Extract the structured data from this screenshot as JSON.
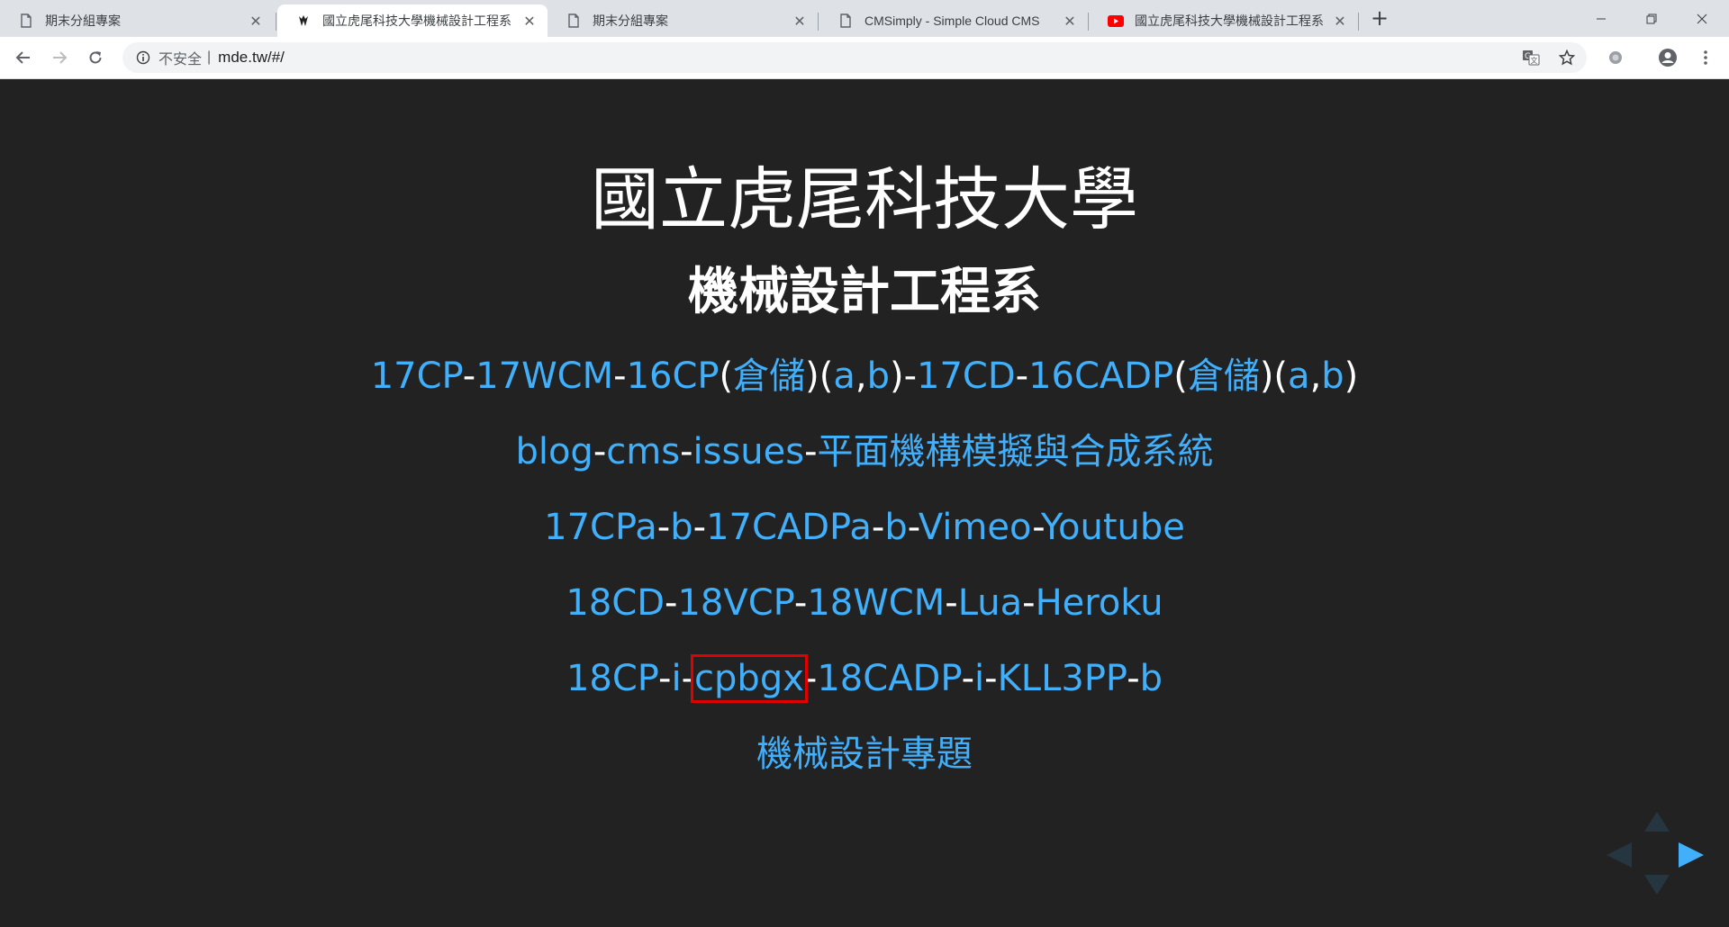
{
  "tabs": [
    {
      "title": "期末分組專案",
      "favicon": "page-icon",
      "active": false
    },
    {
      "title": "國立虎尾科技大學機械設計工程系",
      "favicon": "mde-logo-icon",
      "active": true
    },
    {
      "title": "期末分組專案",
      "favicon": "page-icon",
      "active": false
    },
    {
      "title": "CMSimply - Simple Cloud CMS",
      "favicon": "page-icon",
      "active": false
    },
    {
      "title": "國立虎尾科技大學機械設計工程系",
      "favicon": "youtube-icon",
      "active": false
    }
  ],
  "new_tab_label": "+",
  "omnibox": {
    "security": "不安全",
    "separator": "|",
    "url": "mde.tw/#/"
  },
  "page": {
    "title": "國立虎尾科技大學",
    "subtitle": "機械設計工程系",
    "lines": [
      {
        "segments": [
          {
            "text": "17CP",
            "type": "link"
          },
          {
            "text": "-",
            "type": "dash"
          },
          {
            "text": "17WCM",
            "type": "link"
          },
          {
            "text": "-",
            "type": "dash"
          },
          {
            "text": "16CP",
            "type": "link"
          },
          {
            "text": "(",
            "type": "dash"
          },
          {
            "text": "倉儲",
            "type": "link"
          },
          {
            "text": ")(",
            "type": "dash"
          },
          {
            "text": "a",
            "type": "link"
          },
          {
            "text": ",",
            "type": "dash"
          },
          {
            "text": "b",
            "type": "link"
          },
          {
            "text": ")-",
            "type": "dash"
          },
          {
            "text": "17CD",
            "type": "link"
          },
          {
            "text": "-",
            "type": "dash"
          },
          {
            "text": "16CADP",
            "type": "link"
          },
          {
            "text": "(",
            "type": "dash"
          },
          {
            "text": "倉儲",
            "type": "link"
          },
          {
            "text": ")(",
            "type": "dash"
          },
          {
            "text": "a",
            "type": "link"
          },
          {
            "text": ",",
            "type": "dash"
          },
          {
            "text": "b",
            "type": "link"
          },
          {
            "text": ")",
            "type": "dash"
          }
        ]
      },
      {
        "segments": [
          {
            "text": "blog",
            "type": "link"
          },
          {
            "text": "-",
            "type": "dash"
          },
          {
            "text": "cms",
            "type": "link"
          },
          {
            "text": "-",
            "type": "dash"
          },
          {
            "text": "issues",
            "type": "link"
          },
          {
            "text": "-",
            "type": "dash"
          },
          {
            "text": "平面機構模擬與合成系統",
            "type": "link"
          }
        ]
      },
      {
        "segments": [
          {
            "text": "17CPa",
            "type": "link"
          },
          {
            "text": "-",
            "type": "dash"
          },
          {
            "text": "b",
            "type": "link"
          },
          {
            "text": "-",
            "type": "dash"
          },
          {
            "text": "17CADPa",
            "type": "link"
          },
          {
            "text": "-",
            "type": "dash"
          },
          {
            "text": "b",
            "type": "link"
          },
          {
            "text": "-",
            "type": "dash"
          },
          {
            "text": "Vimeo",
            "type": "link"
          },
          {
            "text": "-",
            "type": "dash"
          },
          {
            "text": "Youtube",
            "type": "link"
          }
        ]
      },
      {
        "segments": [
          {
            "text": "18CD",
            "type": "link"
          },
          {
            "text": "-",
            "type": "dash"
          },
          {
            "text": "18VCP",
            "type": "link"
          },
          {
            "text": "-",
            "type": "dash"
          },
          {
            "text": "18WCM",
            "type": "link"
          },
          {
            "text": "-",
            "type": "dash"
          },
          {
            "text": "Lua",
            "type": "link"
          },
          {
            "text": "-",
            "type": "dash"
          },
          {
            "text": "Heroku",
            "type": "link"
          }
        ]
      },
      {
        "segments": [
          {
            "text": "18CP",
            "type": "link"
          },
          {
            "text": "-",
            "type": "dash"
          },
          {
            "text": "i",
            "type": "link"
          },
          {
            "text": "-",
            "type": "dash"
          },
          {
            "text": "cpbgx",
            "type": "link",
            "highlighted": true
          },
          {
            "text": "-",
            "type": "dash"
          },
          {
            "text": "18CADP",
            "type": "link"
          },
          {
            "text": "-",
            "type": "dash"
          },
          {
            "text": "i",
            "type": "link"
          },
          {
            "text": "-",
            "type": "dash"
          },
          {
            "text": "KLL3PP",
            "type": "link"
          },
          {
            "text": "-",
            "type": "dash"
          },
          {
            "text": "b",
            "type": "link"
          }
        ]
      },
      {
        "segments": [
          {
            "text": "機械設計專題",
            "type": "link"
          }
        ]
      }
    ]
  },
  "colors": {
    "background": "#222222",
    "link": "#42affa",
    "text": "#ffffff",
    "highlight_box": "#e00000",
    "nav_active": "#42affa"
  },
  "controls": {
    "up": "disabled",
    "down": "disabled",
    "left": "disabled",
    "right": "enabled"
  }
}
